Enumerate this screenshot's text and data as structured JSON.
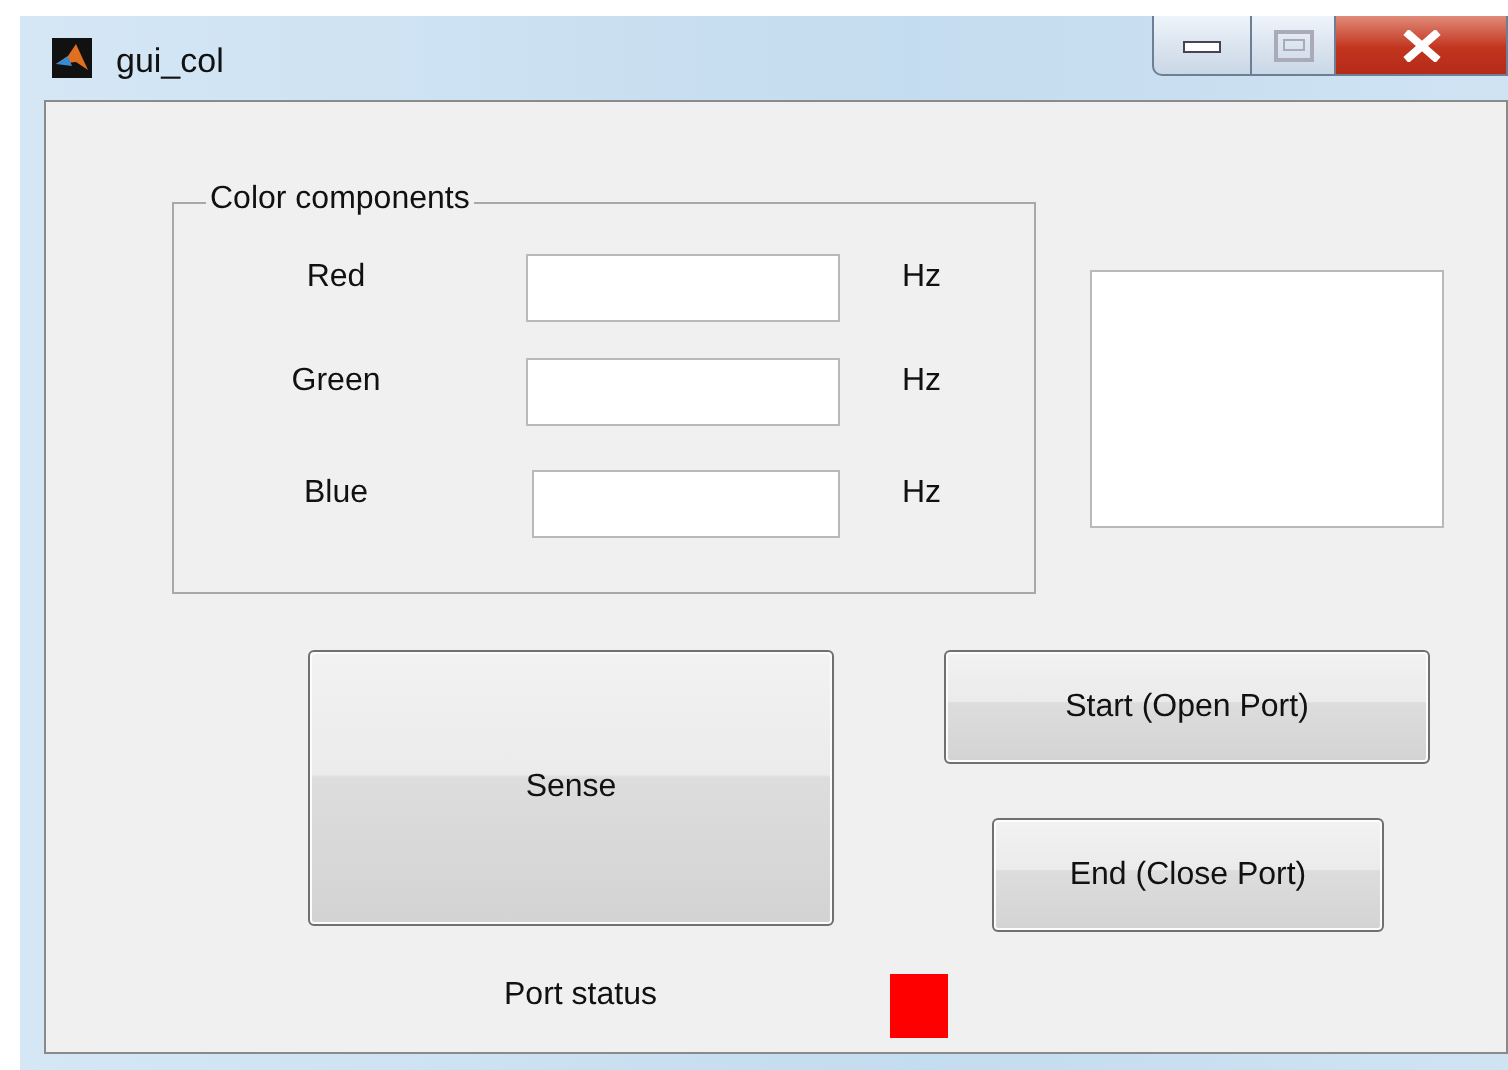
{
  "window": {
    "title": "gui_col"
  },
  "color_components": {
    "title": "Color components",
    "fields": [
      {
        "label": "Red",
        "unit": "Hz"
      },
      {
        "label": "Green",
        "unit": "Hz"
      },
      {
        "label": "Blue",
        "unit": "Hz"
      }
    ]
  },
  "buttons": [
    {
      "label": "Sense",
      "kind": "sense"
    },
    {
      "label": "Start (Open Port)",
      "kind": "start"
    },
    {
      "label": "End (Close Port)",
      "kind": "end"
    }
  ],
  "port_status": {
    "label": "Port status",
    "color": "#ff0000"
  }
}
